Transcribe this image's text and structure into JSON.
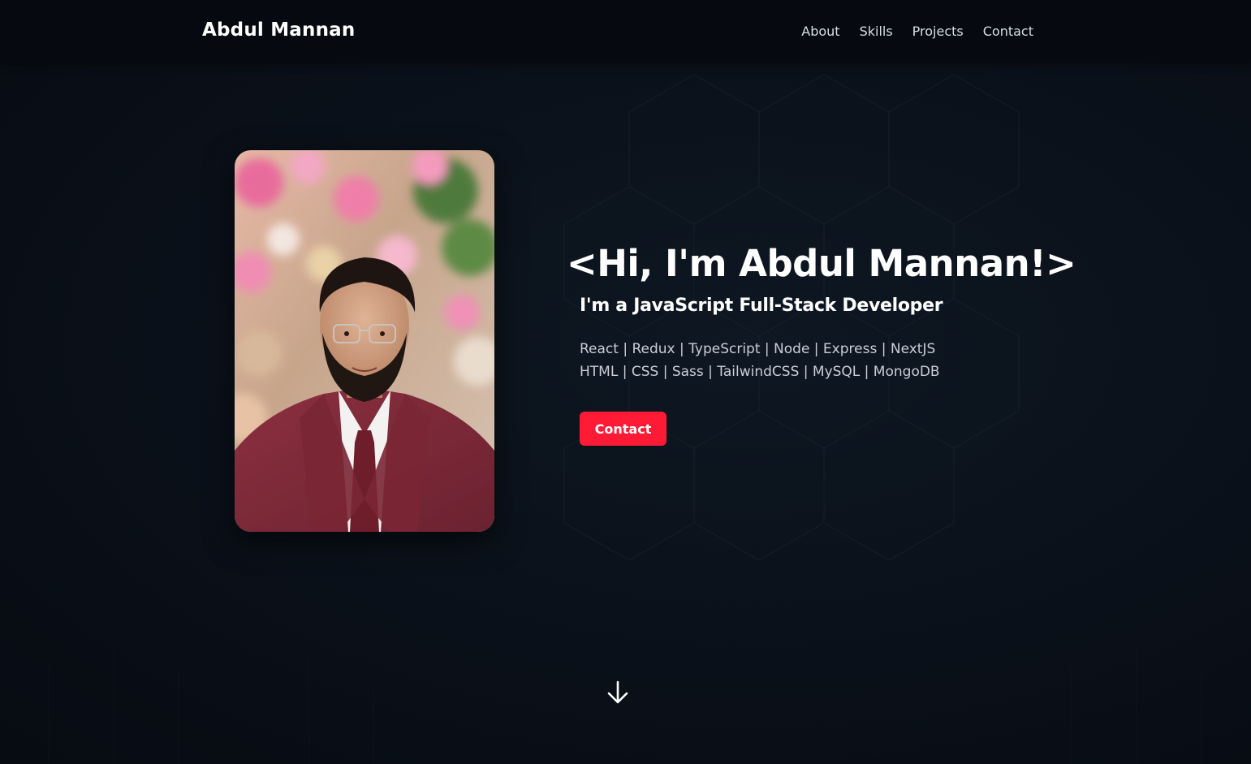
{
  "nav": {
    "brand": "Abdul Mannan",
    "links": [
      "About",
      "Skills",
      "Projects",
      "Contact"
    ]
  },
  "hero": {
    "title": "<Hi, I'm Abdul Mannan!>",
    "subtitle": "I'm a JavaScript Full-Stack Developer",
    "skills_line_1": "React | Redux | TypeScript | Node | Express | NextJS",
    "skills_line_2": "HTML | CSS | Sass | TailwindCSS | MySQL | MongoDB",
    "contact_button": "Contact"
  },
  "icons": {
    "scroll": "arrow-down-icon"
  },
  "colors": {
    "background": "#0a0f18",
    "navbar": "#060a10",
    "accent": "#ff1a36",
    "text": "#ffffff",
    "muted_text": "#c9ced6"
  }
}
